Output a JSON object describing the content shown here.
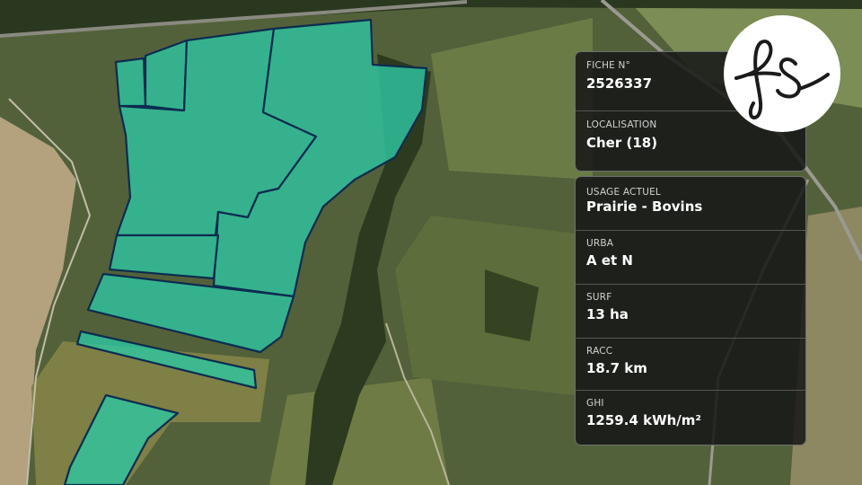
{
  "brand": {
    "logo_icon": "fs-monogram-logo"
  },
  "colors": {
    "parcel_fill": "#2ec4a0",
    "parcel_stroke": "#0c2c50",
    "card_bg": "#161616"
  },
  "info_card": [
    {
      "label": "FICHE N°",
      "value": "2526337"
    },
    {
      "label": "LOCALISATION",
      "value": "Cher (18)"
    }
  ],
  "details_card": [
    {
      "label": "USAGE ACTUEL",
      "value": "Prairie - Bovins"
    },
    {
      "label": "URBA",
      "value": "A et N"
    },
    {
      "label": "SURF",
      "value": "13 ha"
    },
    {
      "label": "RACC",
      "value": "18.7 km"
    },
    {
      "label": "GHI",
      "value": "1259.4 kWh/m²"
    }
  ]
}
